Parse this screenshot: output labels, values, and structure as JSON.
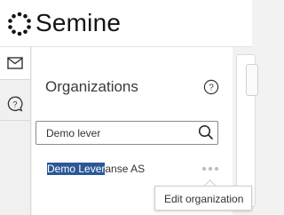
{
  "app": {
    "brand_name": "Semine",
    "logo_icon": "dotted-ring-logo"
  },
  "rail": {
    "items": [
      {
        "icon": "mail-icon",
        "active": true
      },
      {
        "icon": "help-bubble-icon",
        "active": false
      }
    ]
  },
  "panel": {
    "title": "Organizations",
    "help_icon": "help-circle-icon"
  },
  "search": {
    "value": "Demo lever",
    "icon": "search-icon"
  },
  "organizations": [
    {
      "name_highlight": "Demo Lever",
      "name_rest": "anse AS",
      "more_icon": "more-dots-icon"
    }
  ],
  "tooltip": {
    "text": "Edit organization"
  },
  "colors": {
    "highlight": "#2b5797",
    "panel_bg": "#ffffff",
    "app_bg": "#f2f2f2"
  }
}
